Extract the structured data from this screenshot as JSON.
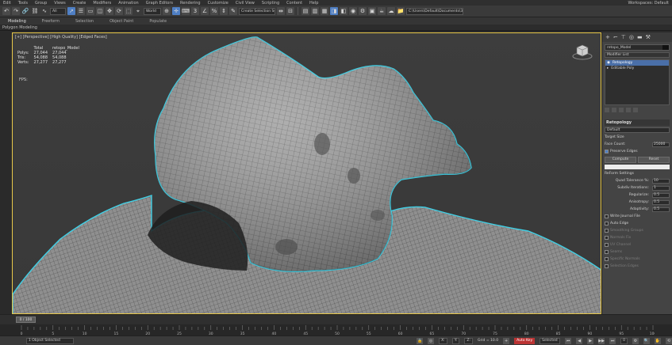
{
  "menubar": {
    "items": [
      "Edit",
      "Tools",
      "Group",
      "Views",
      "Create",
      "Modifiers",
      "Animation",
      "Graph Editors",
      "Rendering",
      "Customize",
      "Civil View",
      "Scripting",
      "Content",
      "Help"
    ],
    "workspace": "Workspaces: Default"
  },
  "toolbar": {
    "view_dropdown": "World",
    "filter_dropdown": "All",
    "selection_set": "Create Selection Se",
    "path": "C:\\Users\\Default\\Documents\\3ds Max"
  },
  "ribbon": {
    "tabs": [
      "Modeling",
      "Freeform",
      "Selection",
      "Object Paint",
      "Populate"
    ],
    "active": "Modeling",
    "sub": "Polygon Modeling"
  },
  "viewport": {
    "label": "[+] [Perspective] [High Quality] [Edged Faces]",
    "stats": {
      "header": [
        "",
        "Total",
        "retopo_Model"
      ],
      "rows": [
        [
          "Polys:",
          "27,044",
          "27,044"
        ],
        [
          "Tris:",
          "54,088",
          "54,088"
        ],
        [
          "Verts:",
          "27,277",
          "27,277"
        ]
      ]
    },
    "fps": "FPS:"
  },
  "cmdpanel": {
    "tabs": [
      "+",
      "modify-icon",
      "hierarchy-icon",
      "motion-icon",
      "display-icon",
      "utilities-icon"
    ],
    "object_name": "retopo_Model",
    "modifier_list": "Modifier List",
    "stack": [
      {
        "label": "Retopology",
        "selected": true
      },
      {
        "label": "Editable Poly",
        "selected": false
      }
    ],
    "rollout_title": "Retopology",
    "preset": "Default",
    "target_size": "Target Size",
    "face_count_label": "Face Count:",
    "face_count": "25000",
    "preserve_edges": "Preserve Edges",
    "compute": "Compute",
    "reset": "Reset",
    "section": "ReForm Settings",
    "quad_tol_label": "Quad Tolerance %:",
    "quad_tol": "10",
    "subdiv_label": "Subdiv Iterations:",
    "subdiv": "1",
    "regularize_label": "Regularize:",
    "regularize": "0.5",
    "anisotropy_label": "Anisotropy:",
    "anisotropy": "0.5",
    "adaptivity_label": "Adaptivity:",
    "adaptivity": "0.5",
    "journal": "Write Journal File",
    "autoedge": "Auto Edge",
    "smoothing": "Smoothing Groups",
    "normals": "Normals Fix",
    "uv_channel": "UV Channel",
    "seams": "Seams",
    "specific": "Specific Normals",
    "selection_edges": "Selection Edges"
  },
  "timeline": {
    "slider": "0 / 100",
    "ticks": [
      "0",
      "5",
      "10",
      "15",
      "20",
      "25",
      "30",
      "35",
      "40",
      "45",
      "50",
      "55",
      "60",
      "65",
      "70",
      "75",
      "80",
      "85",
      "90",
      "95",
      "100"
    ]
  },
  "status": {
    "selection": "1 Object Selected",
    "grid": "Grid = 10.0",
    "autokey": "Auto Key",
    "selected": "Selected",
    "frame": "0"
  },
  "colors": {
    "accent": "#4f7fc4",
    "selection_outline": "#3fd0e6",
    "viewport_border": "#e8c84a"
  }
}
